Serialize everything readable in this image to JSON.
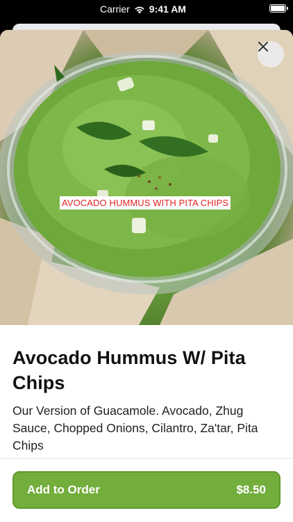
{
  "status_bar": {
    "carrier": "Carrier",
    "time": "9:41 AM"
  },
  "photo": {
    "caption": "AVOCADO HUMMUS WITH PITA CHIPS",
    "close_icon": "close-icon"
  },
  "item": {
    "title": "Avocado Hummus W/ Pita Chips",
    "description": "Our Version of Guacamole.  Avocado, Zhug Sauce, Chopped Onions, Cilantro, Za'tar, Pita Chips"
  },
  "action": {
    "label": "Add to Order",
    "price": "$8.50"
  },
  "colors": {
    "accent": "#73ad3c",
    "caption_text": "#e02424"
  }
}
